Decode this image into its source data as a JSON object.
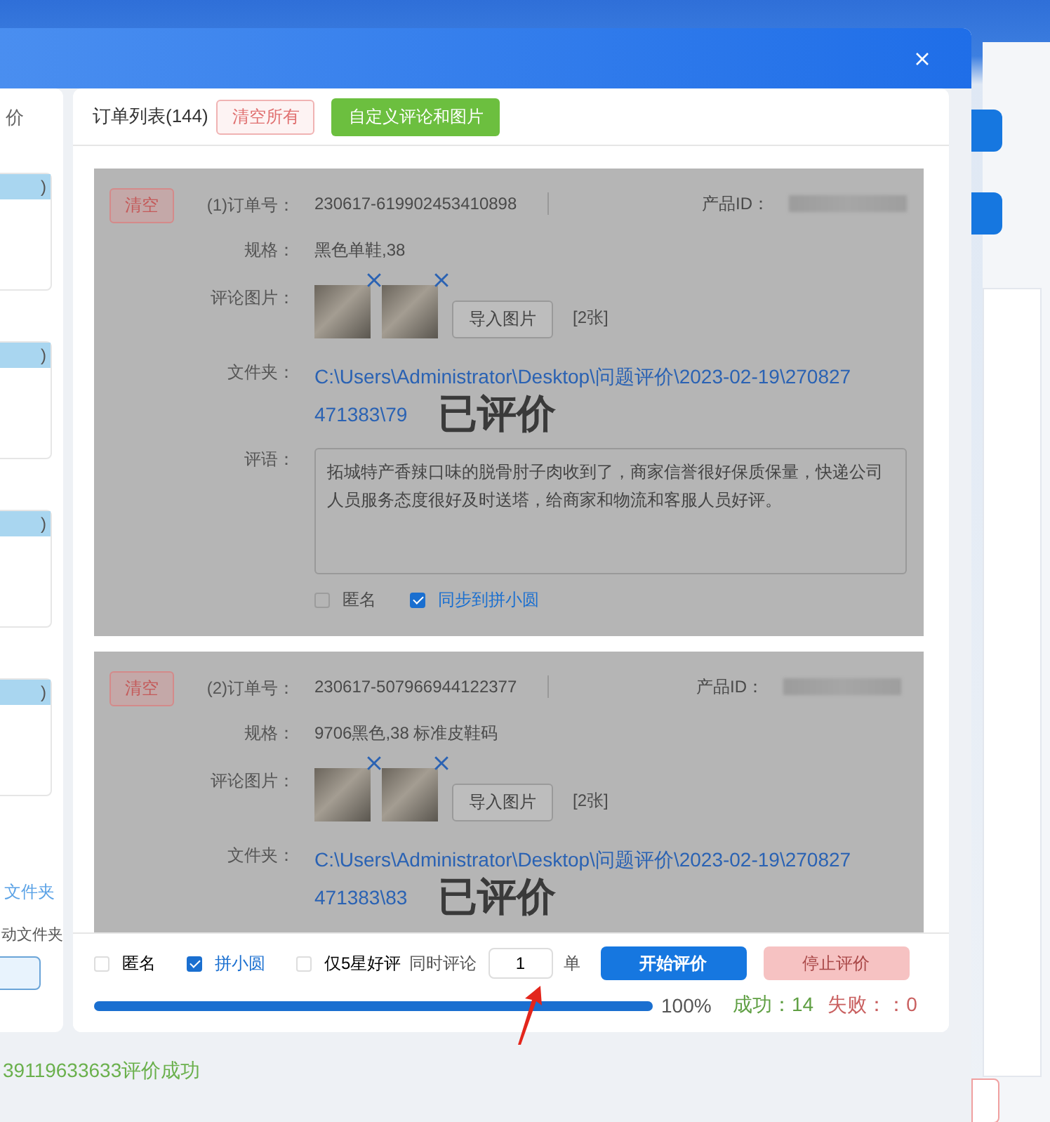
{
  "left_panel": {
    "header": "价",
    "groups": [
      {
        "label": ")"
      },
      {
        "label": ")"
      },
      {
        "label": ")"
      },
      {
        "label": ")"
      }
    ],
    "folder_link": "文件夹",
    "auto_folder": "动文件夹"
  },
  "order_list": {
    "title": "订单列表(144)",
    "clear_all": "清空所有",
    "custom_button": "自定义评论和图片"
  },
  "orders": [
    {
      "clear_label": "清空",
      "order_label": "(1)订单号：",
      "order_no": "230617-619902453410898",
      "product_id_label": "产品ID：",
      "spec_label": "规格：",
      "spec": "黑色单鞋,38",
      "images_label": "评论图片：",
      "images": [
        {
          "removable": true
        },
        {
          "removable": true
        }
      ],
      "import_button": "导入图片",
      "image_count": "[2张]",
      "folder_label": "文件夹：",
      "folder_path_lines": [
        "C:\\Users\\Administrator\\Desktop\\问题评价\\2023-02-19\\270827",
        "471383\\79"
      ],
      "stamp": "已评价",
      "comment_label": "评语：",
      "comment": "拓城特产香辣口味的脱骨肘子肉收到了，商家信誉很好保质保量，快递公司人员服务态度很好及时送塔，给商家和物流和客服人员好评。",
      "anonymous": {
        "label": "匿名",
        "checked": false
      },
      "sync": {
        "label": "同步到拼小圆",
        "checked": true
      }
    },
    {
      "clear_label": "清空",
      "order_label": "(2)订单号：",
      "order_no": "230617-507966944122377",
      "product_id_label": "产品ID：",
      "spec_label": "规格：",
      "spec": "9706黑色,38 标准皮鞋码",
      "images_label": "评论图片：",
      "images": [
        {
          "removable": true
        },
        {
          "removable": true
        }
      ],
      "import_button": "导入图片",
      "image_count": "[2张]",
      "folder_label": "文件夹：",
      "folder_path_lines": [
        "C:\\Users\\Administrator\\Desktop\\问题评价\\2023-02-19\\270827",
        "471383\\83"
      ],
      "stamp": "已评价"
    }
  ],
  "bottom_bar": {
    "options": [
      {
        "label": "匿名",
        "checked": false
      },
      {
        "label": "拼小圆",
        "checked": true
      },
      {
        "label": "仅5星好评",
        "checked": false
      }
    ],
    "concurrent_label": "同时评论",
    "concurrent_value": "1",
    "unit": "单",
    "start_button": "开始评价",
    "stop_button": {
      "label": "停止评价",
      "disabled": true
    },
    "progress": {
      "level": 1,
      "reading": "100%"
    },
    "success": "成功：14",
    "failure": "失败：：0"
  },
  "status_message": "39119633633评价成功"
}
